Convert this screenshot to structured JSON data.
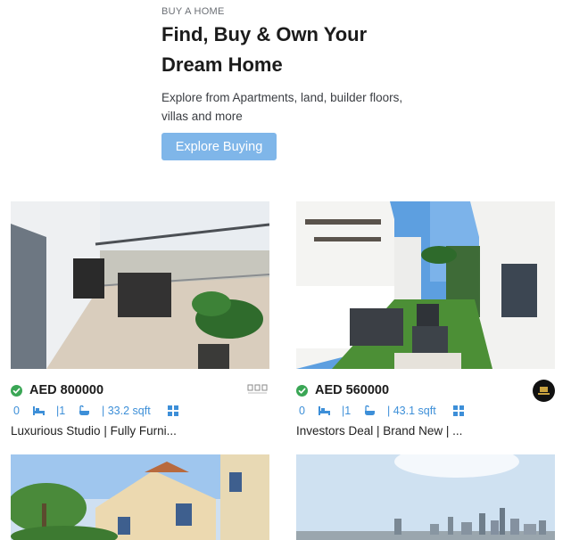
{
  "hero": {
    "eyebrow": "BUY A HOME",
    "headline_line1": "Find, Buy & Own Your",
    "headline_line2": "Dream Home",
    "subtitle_line1": "Explore from Apartments, land, builder floors,",
    "subtitle_line2": "villas and more",
    "cta_label": "Explore Buying"
  },
  "colors": {
    "accent": "#7fb6e9",
    "link_blue": "#3d8fd8",
    "verified_green": "#3aa655"
  },
  "listings": [
    {
      "price": "AED 800000",
      "bedrooms": "0",
      "bathrooms": "|1",
      "area": "| 33.2 sqft",
      "title": "Luxurious Studio | Fully Furni...",
      "icons": [
        "verified-badge-icon",
        "bed-icon",
        "bathtub-icon",
        "floorplan-icon",
        "agency-logo"
      ]
    },
    {
      "price": "AED 560000",
      "bedrooms": "0",
      "bathrooms": "|1",
      "area": "| 43.1 sqft",
      "title": "Investors Deal | Brand New | ...",
      "icons": [
        "verified-badge-icon",
        "bed-icon",
        "bathtub-icon",
        "floorplan-icon",
        "agency-logo"
      ]
    },
    {
      "title": ""
    },
    {
      "title": ""
    }
  ]
}
